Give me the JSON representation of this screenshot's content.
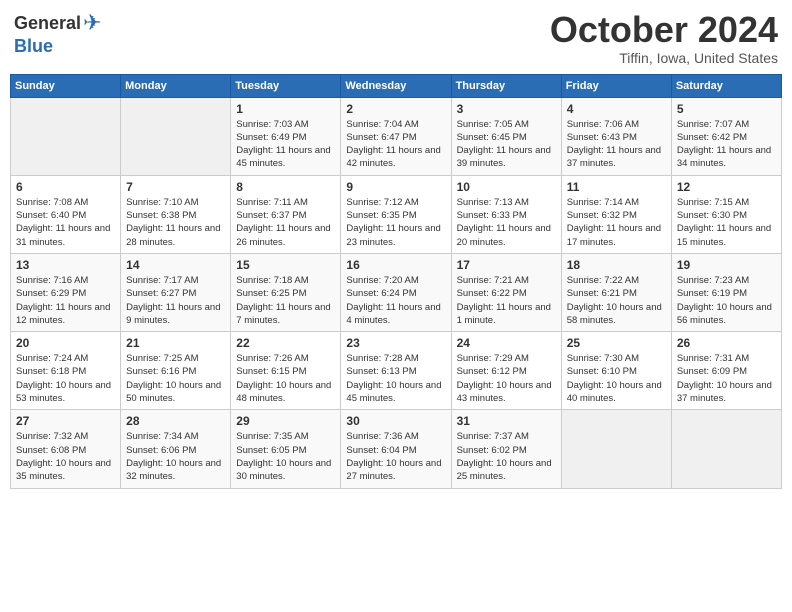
{
  "header": {
    "logo": {
      "general": "General",
      "blue": "Blue"
    },
    "title": "October 2024",
    "subtitle": "Tiffin, Iowa, United States"
  },
  "weekdays": [
    "Sunday",
    "Monday",
    "Tuesday",
    "Wednesday",
    "Thursday",
    "Friday",
    "Saturday"
  ],
  "weeks": [
    [
      {
        "day": "",
        "info": ""
      },
      {
        "day": "",
        "info": ""
      },
      {
        "day": "1",
        "info": "Sunrise: 7:03 AM\nSunset: 6:49 PM\nDaylight: 11 hours and 45 minutes."
      },
      {
        "day": "2",
        "info": "Sunrise: 7:04 AM\nSunset: 6:47 PM\nDaylight: 11 hours and 42 minutes."
      },
      {
        "day": "3",
        "info": "Sunrise: 7:05 AM\nSunset: 6:45 PM\nDaylight: 11 hours and 39 minutes."
      },
      {
        "day": "4",
        "info": "Sunrise: 7:06 AM\nSunset: 6:43 PM\nDaylight: 11 hours and 37 minutes."
      },
      {
        "day": "5",
        "info": "Sunrise: 7:07 AM\nSunset: 6:42 PM\nDaylight: 11 hours and 34 minutes."
      }
    ],
    [
      {
        "day": "6",
        "info": "Sunrise: 7:08 AM\nSunset: 6:40 PM\nDaylight: 11 hours and 31 minutes."
      },
      {
        "day": "7",
        "info": "Sunrise: 7:10 AM\nSunset: 6:38 PM\nDaylight: 11 hours and 28 minutes."
      },
      {
        "day": "8",
        "info": "Sunrise: 7:11 AM\nSunset: 6:37 PM\nDaylight: 11 hours and 26 minutes."
      },
      {
        "day": "9",
        "info": "Sunrise: 7:12 AM\nSunset: 6:35 PM\nDaylight: 11 hours and 23 minutes."
      },
      {
        "day": "10",
        "info": "Sunrise: 7:13 AM\nSunset: 6:33 PM\nDaylight: 11 hours and 20 minutes."
      },
      {
        "day": "11",
        "info": "Sunrise: 7:14 AM\nSunset: 6:32 PM\nDaylight: 11 hours and 17 minutes."
      },
      {
        "day": "12",
        "info": "Sunrise: 7:15 AM\nSunset: 6:30 PM\nDaylight: 11 hours and 15 minutes."
      }
    ],
    [
      {
        "day": "13",
        "info": "Sunrise: 7:16 AM\nSunset: 6:29 PM\nDaylight: 11 hours and 12 minutes."
      },
      {
        "day": "14",
        "info": "Sunrise: 7:17 AM\nSunset: 6:27 PM\nDaylight: 11 hours and 9 minutes."
      },
      {
        "day": "15",
        "info": "Sunrise: 7:18 AM\nSunset: 6:25 PM\nDaylight: 11 hours and 7 minutes."
      },
      {
        "day": "16",
        "info": "Sunrise: 7:20 AM\nSunset: 6:24 PM\nDaylight: 11 hours and 4 minutes."
      },
      {
        "day": "17",
        "info": "Sunrise: 7:21 AM\nSunset: 6:22 PM\nDaylight: 11 hours and 1 minute."
      },
      {
        "day": "18",
        "info": "Sunrise: 7:22 AM\nSunset: 6:21 PM\nDaylight: 10 hours and 58 minutes."
      },
      {
        "day": "19",
        "info": "Sunrise: 7:23 AM\nSunset: 6:19 PM\nDaylight: 10 hours and 56 minutes."
      }
    ],
    [
      {
        "day": "20",
        "info": "Sunrise: 7:24 AM\nSunset: 6:18 PM\nDaylight: 10 hours and 53 minutes."
      },
      {
        "day": "21",
        "info": "Sunrise: 7:25 AM\nSunset: 6:16 PM\nDaylight: 10 hours and 50 minutes."
      },
      {
        "day": "22",
        "info": "Sunrise: 7:26 AM\nSunset: 6:15 PM\nDaylight: 10 hours and 48 minutes."
      },
      {
        "day": "23",
        "info": "Sunrise: 7:28 AM\nSunset: 6:13 PM\nDaylight: 10 hours and 45 minutes."
      },
      {
        "day": "24",
        "info": "Sunrise: 7:29 AM\nSunset: 6:12 PM\nDaylight: 10 hours and 43 minutes."
      },
      {
        "day": "25",
        "info": "Sunrise: 7:30 AM\nSunset: 6:10 PM\nDaylight: 10 hours and 40 minutes."
      },
      {
        "day": "26",
        "info": "Sunrise: 7:31 AM\nSunset: 6:09 PM\nDaylight: 10 hours and 37 minutes."
      }
    ],
    [
      {
        "day": "27",
        "info": "Sunrise: 7:32 AM\nSunset: 6:08 PM\nDaylight: 10 hours and 35 minutes."
      },
      {
        "day": "28",
        "info": "Sunrise: 7:34 AM\nSunset: 6:06 PM\nDaylight: 10 hours and 32 minutes."
      },
      {
        "day": "29",
        "info": "Sunrise: 7:35 AM\nSunset: 6:05 PM\nDaylight: 10 hours and 30 minutes."
      },
      {
        "day": "30",
        "info": "Sunrise: 7:36 AM\nSunset: 6:04 PM\nDaylight: 10 hours and 27 minutes."
      },
      {
        "day": "31",
        "info": "Sunrise: 7:37 AM\nSunset: 6:02 PM\nDaylight: 10 hours and 25 minutes."
      },
      {
        "day": "",
        "info": ""
      },
      {
        "day": "",
        "info": ""
      }
    ]
  ]
}
